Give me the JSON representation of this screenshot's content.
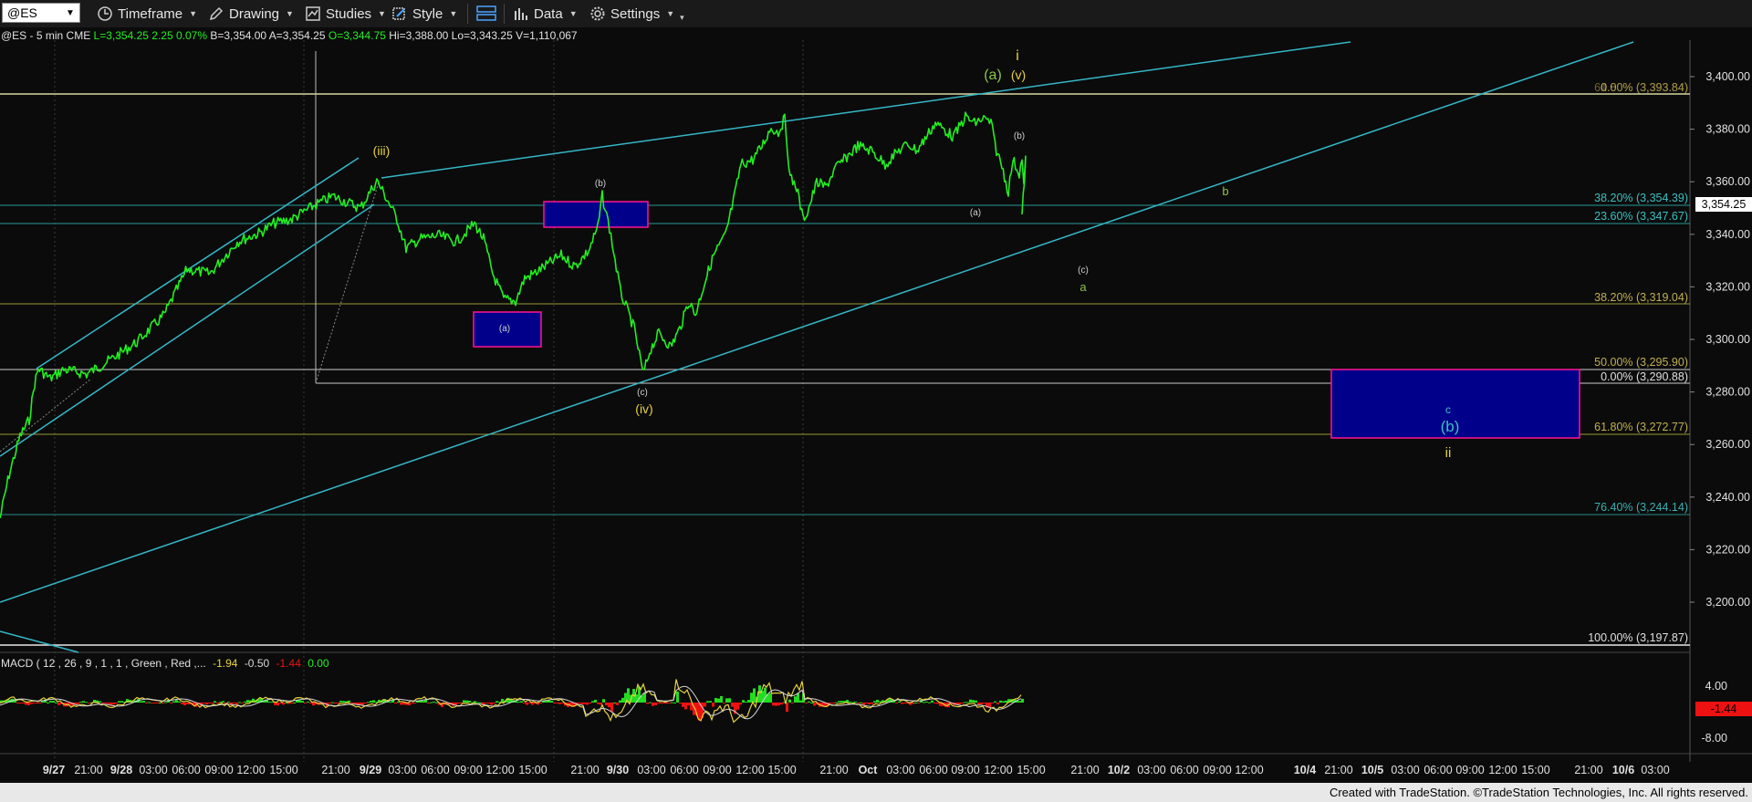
{
  "toolbar": {
    "symbol": "@ES",
    "timeframe_label": "Timeframe",
    "drawing_label": "Drawing",
    "studies_label": "Studies",
    "style_label": "Style",
    "data_label": "Data",
    "settings_label": "Settings"
  },
  "header": {
    "symbol_line": "@ES - 5 min  CME",
    "last": "L=3,354.25",
    "change": "2.25",
    "change_pct": "0.07%",
    "bid": "B=3,354.00",
    "ask": "A=3,354.25",
    "open": "O=3,344.75",
    "high": "Hi=3,388.00",
    "low": "Lo=3,343.25",
    "volume": "V=1,110,067"
  },
  "macd_header": {
    "label": "MACD ( 12 , 26 , 9 , 1 , 1 , Green , Red ,...",
    "v1": "-1.94",
    "v2": "-0.50",
    "v3": "-1.44",
    "v4": "0.00"
  },
  "price_axis": [
    "3,400.00",
    "3,380.00",
    "3,360.00",
    "3,340.00",
    "3,320.00",
    "3,300.00",
    "3,280.00",
    "3,260.00",
    "3,240.00",
    "3,220.00",
    "3,200.00"
  ],
  "last_price_tag": "3,354.25",
  "macd_axis": [
    "4.00",
    "-8.00"
  ],
  "macd_tag": "-1.44",
  "time_axis": [
    "9/27",
    "21:00",
    "9/28",
    "03:00",
    "06:00",
    "09:00",
    "12:00",
    "15:00",
    "21:00",
    "9/29",
    "03:00",
    "06:00",
    "09:00",
    "12:00",
    "15:00",
    "21:00",
    "9/30",
    "03:00",
    "06:00",
    "09:00",
    "12:00",
    "15:00",
    "21:00",
    "Oct",
    "03:00",
    "06:00",
    "09:00",
    "12:00",
    "15:00",
    "21:00",
    "10/2",
    "03:00",
    "06:00",
    "09:00",
    "12:00",
    "10/4",
    "21:00",
    "10/5",
    "03:00",
    "06:00",
    "09:00",
    "12:00",
    "15:00",
    "21:00",
    "10/6",
    "03:00"
  ],
  "fib_labels": [
    "0.00% (3,393.84)",
    "61.80% (3,393.84)",
    "38.20% (3,354.39)",
    "23.60% (3,347.67)",
    "38.20% (3,319.04)",
    "50.00% (3,295.90)",
    "0.00% (3,290.88)",
    "61.80% (3,272.77)",
    "76.40% (3,244.14)",
    "100.00% (3,197.87)"
  ],
  "wave_labels": [
    "(iii)",
    "(b)",
    "(a)",
    "(c)",
    "(iv)",
    "(a)",
    "(v)",
    "i",
    "(b)",
    "(a)",
    "b",
    "(c)",
    "a",
    "c",
    "(b)",
    "ii"
  ],
  "colors": {
    "bullish": "#22dd22",
    "bearish": "#ee1111",
    "trend": "#35b7c7",
    "fib_yellow": "#9a9a3a",
    "fib_cyan": "#2a8a8a",
    "box_fill": "#00008b",
    "box_border": "#ff1493",
    "label_yellow": "#e6d23c",
    "label_green": "#8bc34a"
  },
  "footer": "Created with TradeStation. ©TradeStation Technologies, Inc. All rights reserved."
}
